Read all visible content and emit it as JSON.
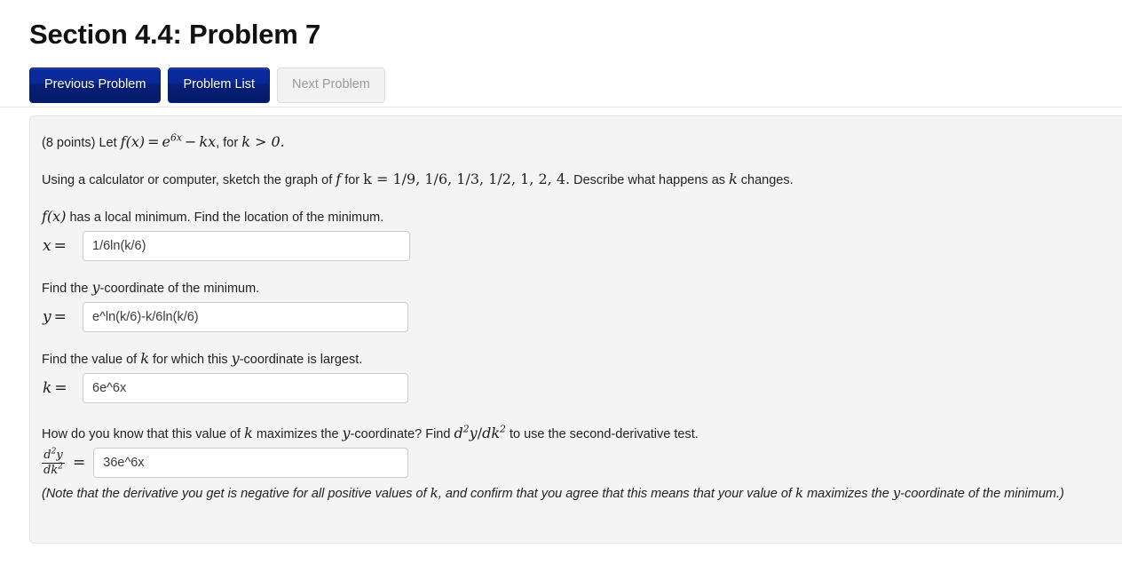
{
  "header": {
    "title": "Section 4.4: Problem 7"
  },
  "nav": {
    "previous_label": "Previous Problem",
    "list_label": "Problem List",
    "next_label": "Next Problem",
    "accent_color": "#0a2a9c",
    "disabled_color": "#9a9a9a"
  },
  "problem": {
    "points_prefix": "(8 points) Let",
    "definition": {
      "f_of_x": "f(x)",
      "equals": "=",
      "exp_base": "e",
      "exp_power": "6x",
      "minus": "−",
      "kx": "kx",
      "for_text": ", for",
      "condition": "k > 0."
    },
    "sketch_text_before": "Using a calculator or computer, sketch the graph of",
    "sketch_f": "f",
    "sketch_for": "for",
    "sketch_k_values": "k = 1/9, 1/6, 1/3, 1/2, 1, 2, 4.",
    "sketch_text_after": "Describe what happens as",
    "sketch_k": "k",
    "sketch_changes": "changes.",
    "q1_math": "f(x)",
    "q1_text": "has a local minimum. Find the location of the minimum.",
    "q2_text_before": "Find the",
    "q2_math": "y",
    "q2_text_after": "-coordinate of the minimum.",
    "q3_text_before": "Find the value of",
    "q3_math_k": "k",
    "q3_text_mid": "for which this",
    "q3_math_y": "y",
    "q3_text_after": "-coordinate is largest.",
    "q4_text_before": "How do you know that this value of",
    "q4_math_k": "k",
    "q4_text_mid": "maximizes the",
    "q4_math_y": "y",
    "q4_text_mid2": "-coordinate? Find",
    "q4_math_deriv": "d²y/dk²",
    "q4_text_after": "to use the second-derivative test.",
    "note_part1": "(Note that the derivative you get is negative for all positive values of",
    "note_k1": "k",
    "note_part2": ", and confirm that you agree that this means that your value of",
    "note_k2": "k",
    "note_part3": "maximizes the",
    "note_y": "y",
    "note_part4": "-coordinate of the minimum.)"
  },
  "answers": {
    "x": {
      "label": "x",
      "equals": "=",
      "value": "1/6ln(k/6)",
      "placeholder": ""
    },
    "y": {
      "label": "y",
      "equals": "=",
      "value": "e^ln(k/6)-k/6ln(k/6)",
      "placeholder": ""
    },
    "k": {
      "label": "k",
      "equals": "=",
      "value": "6e^6x",
      "placeholder": ""
    },
    "d2y": {
      "numerator": "d",
      "numerator_sup": "2",
      "numerator_var": "y",
      "denominator": "dk",
      "denominator_sup": "2",
      "equals": "=",
      "value": "36e^6x",
      "placeholder": ""
    }
  }
}
